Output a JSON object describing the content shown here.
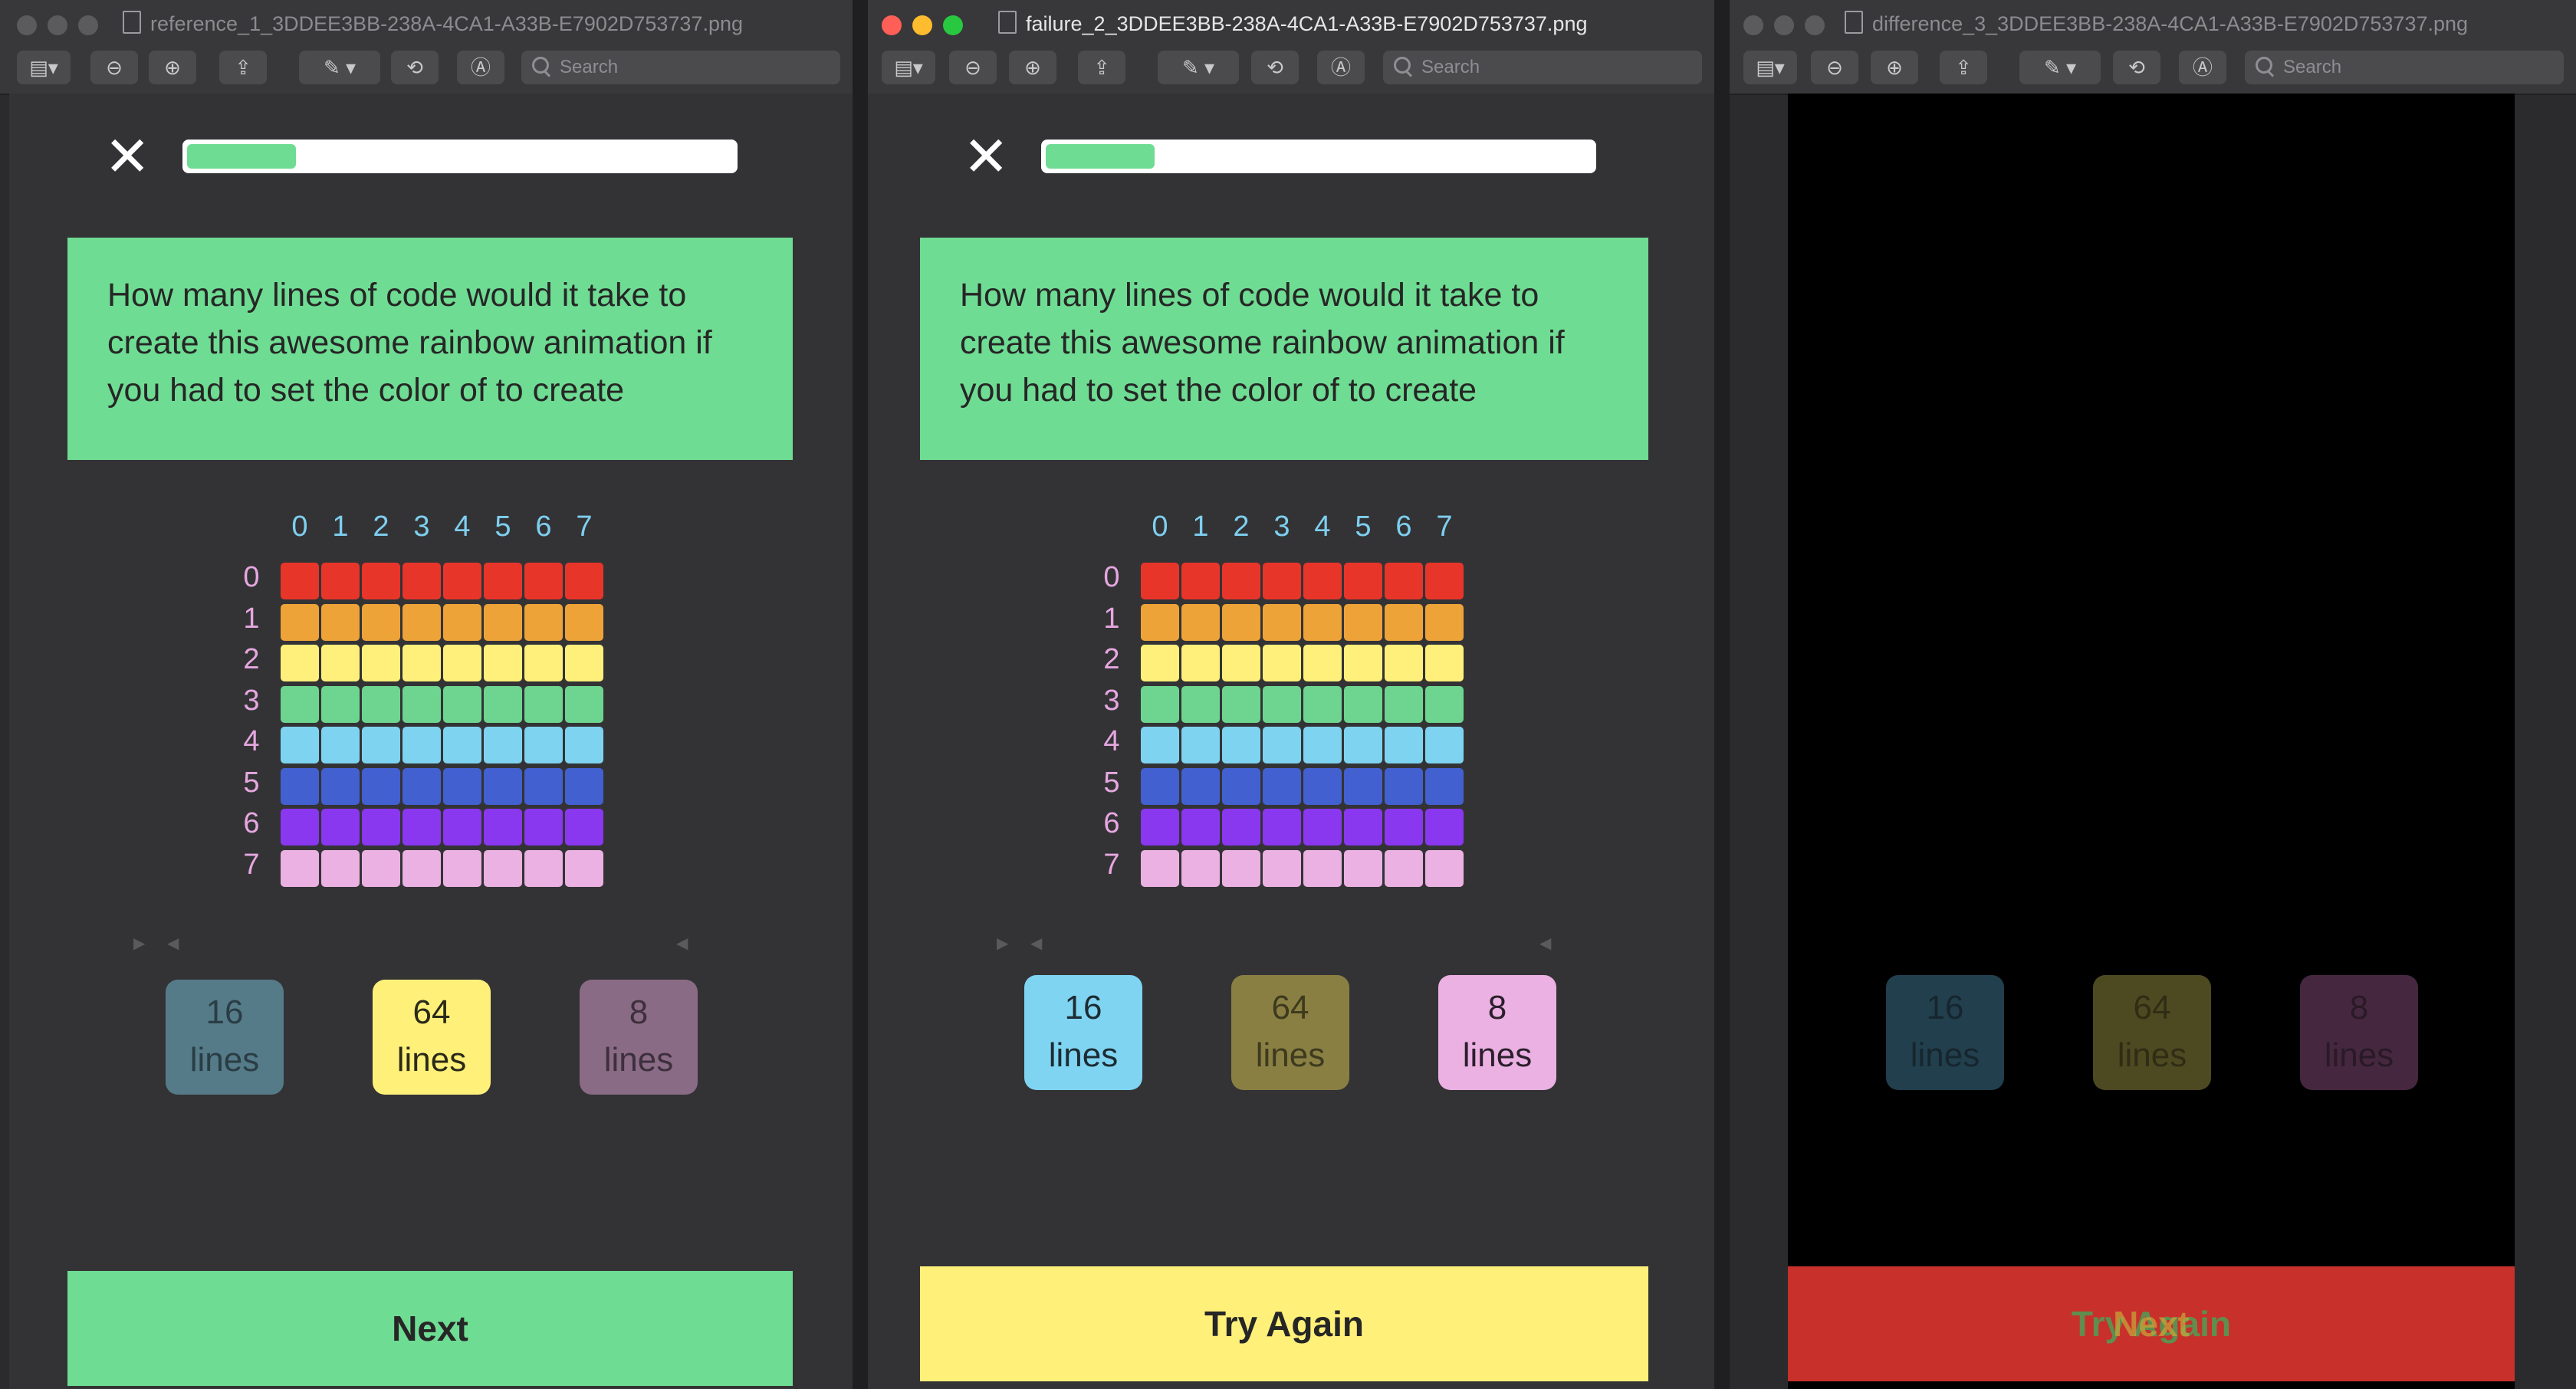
{
  "windows": [
    {
      "title": "reference_1_3DDEE3BB-238A-4CA1-A33B-E7902D753737.png",
      "search_placeholder": "Search"
    },
    {
      "title": "failure_2_3DDEE3BB-238A-4CA1-A33B-E7902D753737.png",
      "search_placeholder": "Search"
    },
    {
      "title": "difference_3_3DDEE3BB-238A-4CA1-A33B-E7902D753737.png",
      "search_placeholder": "Search"
    }
  ],
  "app": {
    "close_glyph": "✕",
    "progress": 0.2,
    "question": "How many lines of code would it take to create this awesome rainbow animation if you had to set the color of to create",
    "column_numbers": [
      "0",
      "1",
      "2",
      "3",
      "4",
      "5",
      "6",
      "7"
    ],
    "row_numbers": [
      "0",
      "1",
      "2",
      "3",
      "4",
      "5",
      "6",
      "7"
    ],
    "row_colors": [
      "#e8352a",
      "#eda338",
      "#fef07a",
      "#6dd58f",
      "#7ed3f0",
      "#4360d0",
      "#8a37f0",
      "#eab1e2"
    ],
    "options": [
      {
        "number": "16",
        "unit": "lines"
      },
      {
        "number": "64",
        "unit": "lines"
      },
      {
        "number": "8",
        "unit": "lines"
      }
    ]
  },
  "reference": {
    "button_label": "Next",
    "button_color": "#6fdc93",
    "option_colors": [
      "#557b89",
      "#fff07a",
      "#8a6b86"
    ],
    "option_text_colors": [
      "#2a3d44",
      "#2a2a1a",
      "#3e2f3c"
    ]
  },
  "failure": {
    "button_label": "Try Again",
    "button_color": "#fff07a",
    "option_colors": [
      "#7fd4f2",
      "#8a7f43",
      "#eab1e2"
    ],
    "option_text_colors": [
      "#1d2b33",
      "#3d3a1e",
      "#2b1f2b"
    ]
  },
  "difference": {
    "button_label_a": "Try Again",
    "button_label_b": "Next",
    "button_color": "#c8302b",
    "option_colors": [
      "#223f4d",
      "#4d4a22",
      "#45283f"
    ],
    "option_text_colors": [
      "#16262e",
      "#2f2d14",
      "#2a1926"
    ]
  }
}
